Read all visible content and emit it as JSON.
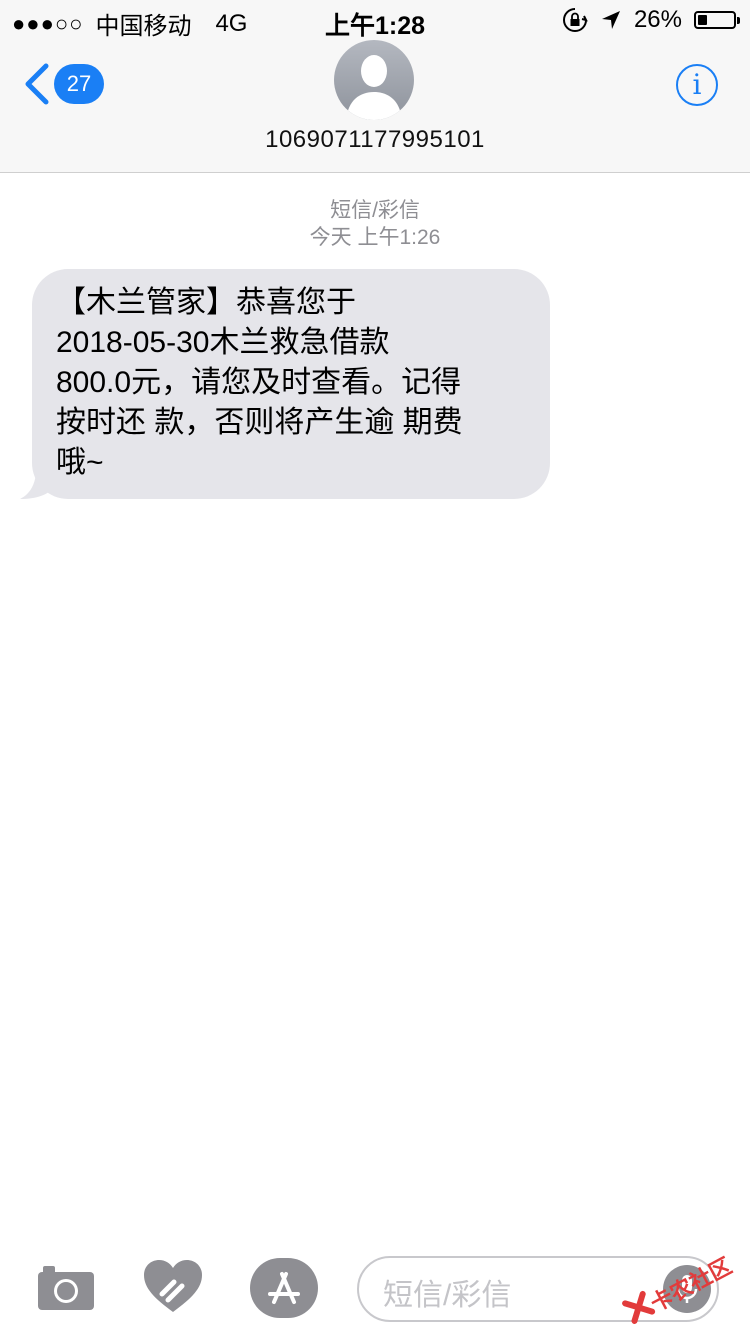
{
  "status_bar": {
    "signal_dots": "●●●○○",
    "carrier": "中国移动",
    "network": "4G",
    "time": "上午1:28",
    "battery_percent_label": "26%",
    "battery_level": 0.26
  },
  "header": {
    "back_count": "27",
    "contact_name": "1069071177995101",
    "info_label": "i"
  },
  "conversation": {
    "meta_type": "短信/彩信",
    "meta_time": "今天 上午1:26",
    "message_lines": [
      "【木兰管家】恭喜您于",
      "2018-05-30木兰救急借款",
      "800.0元，请您及时查看。记得",
      "按时还 款，否则将产生逾 期费",
      "哦~"
    ]
  },
  "input_bar": {
    "placeholder": "短信/彩信"
  },
  "watermark": {
    "text": "卡农社区"
  },
  "colors": {
    "accent": "#1a7ff5",
    "bubble": "#e5e5ea",
    "meta_text": "#8e8e93",
    "icon_gray": "#8e8e93"
  }
}
